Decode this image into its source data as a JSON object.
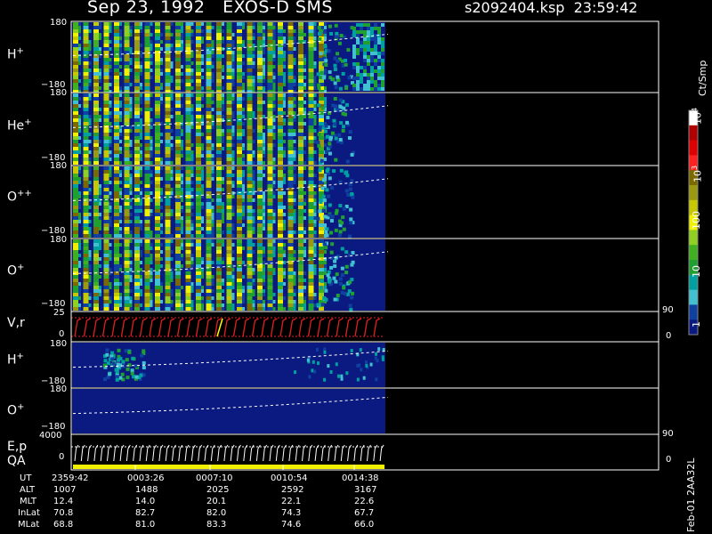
{
  "header": {
    "title": "Sep 23, 1992   EXOS-D SMS",
    "file": "s2092404.ksp  23:59:42"
  },
  "colorbar": {
    "unit": "Ct/Smp",
    "ticks": [
      "10",
      "10",
      "100",
      "10",
      "1"
    ],
    "exponents": [
      "4",
      "3"
    ],
    "colors": [
      "#ffffff",
      "#b00000",
      "#e00000",
      "#ff2020",
      "#7a6a00",
      "#9a9a10",
      "#c8c800",
      "#f0f000",
      "#90d020",
      "#40b020",
      "#20a030",
      "#00a0a0",
      "#40c0d0",
      "#1040a0",
      "#0a1a80"
    ]
  },
  "panels": {
    "h_plus": {
      "name": "H",
      "sup": "+",
      "ymax": "180",
      "ymin": "−180"
    },
    "he_plus": {
      "name": "He",
      "sup": "+",
      "ymax": "180",
      "ymin": "−180"
    },
    "opp": {
      "name": "O",
      "sup": "++",
      "ymax": "180",
      "ymin": "−180"
    },
    "o_plus": {
      "name": "O",
      "sup": "+",
      "ymax": "180",
      "ymin": "−180"
    },
    "vr": {
      "name": "V,r",
      "ymax": "25",
      "ymin": "0",
      "rmax": "90",
      "rmin": "0"
    },
    "h_plus_b": {
      "name": "H",
      "sup": "+",
      "ymax": "180",
      "ymin": "−180"
    },
    "o_plus_b": {
      "name": "O",
      "sup": "+",
      "ymax": "180",
      "ymin": "−180"
    },
    "ep": {
      "name": "E,p",
      "name2": "QA",
      "ymax": "4000",
      "ymin": "0",
      "rmax": "90",
      "rmin": "0"
    }
  },
  "ephemeris": {
    "rows": [
      {
        "label": "UT",
        "values": [
          "2359:42",
          "0003:26",
          "0007:10",
          "0010:54",
          "0014:38"
        ]
      },
      {
        "label": "ALT",
        "values": [
          "1007",
          "1488",
          "2025",
          "2592",
          "3167"
        ]
      },
      {
        "label": "MLT",
        "values": [
          "12.4",
          "14.0",
          "20.1",
          "22.1",
          "22.6"
        ]
      },
      {
        "label": "InLat",
        "values": [
          "70.8",
          "82.7",
          "82.0",
          "74.3",
          "67.7"
        ]
      },
      {
        "label": "MLat",
        "values": [
          "68.8",
          "81.0",
          "83.3",
          "74.6",
          "66.0"
        ]
      }
    ]
  },
  "footer": {
    "version": "Feb-01 2AA32L"
  },
  "chart_data": {
    "type": "heatmap",
    "title": "Sep 23, 1992   EXOS-D SMS",
    "x": [
      "2359:42",
      "0003:26",
      "0007:10",
      "0010:54",
      "0014:38"
    ],
    "panels": [
      "H+",
      "He+",
      "O++",
      "O+",
      "V,r",
      "H+",
      "O+",
      "E,p QA"
    ],
    "ylim": [
      -180,
      180
    ],
    "colorbar_ticks": [
      1,
      10,
      100,
      1000,
      10000
    ],
    "colorbar_unit": "Ct/Smp"
  }
}
